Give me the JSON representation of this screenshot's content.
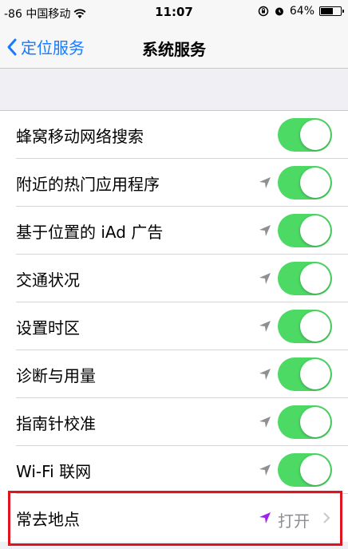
{
  "status_bar": {
    "carrier": "-86 中国移动",
    "time": "11:07",
    "battery": "64%",
    "battery_level": 0.64
  },
  "nav": {
    "back_label": "定位服务",
    "title": "系统服务"
  },
  "items": [
    {
      "label": "蜂窝移动网络搜索",
      "toggle": true
    },
    {
      "label": "附近的热门应用程序",
      "toggle": true,
      "location_icon": "gray-arrow"
    },
    {
      "label": "基于位置的 iAd 广告",
      "toggle": true,
      "location_icon": "gray-arrow"
    },
    {
      "label": "交通状况",
      "toggle": true,
      "location_icon": "gray-arrow"
    },
    {
      "label": "设置时区",
      "toggle": true,
      "location_icon": "gray-arrow"
    },
    {
      "label": "诊断与用量",
      "toggle": true,
      "location_icon": "gray-arrow"
    },
    {
      "label": "指南针校准",
      "toggle": true,
      "location_icon": "gray-arrow"
    },
    {
      "label": "Wi-Fi 联网",
      "toggle": true,
      "location_icon": "gray-arrow"
    },
    {
      "label": "常去地点",
      "value": "打开",
      "location_icon": "purple-arrow"
    }
  ],
  "colors": {
    "accent": "#1a7aff",
    "toggle_on": "#4cd964",
    "highlight": "#e0141e",
    "purple_arrow": "#a020f0"
  }
}
